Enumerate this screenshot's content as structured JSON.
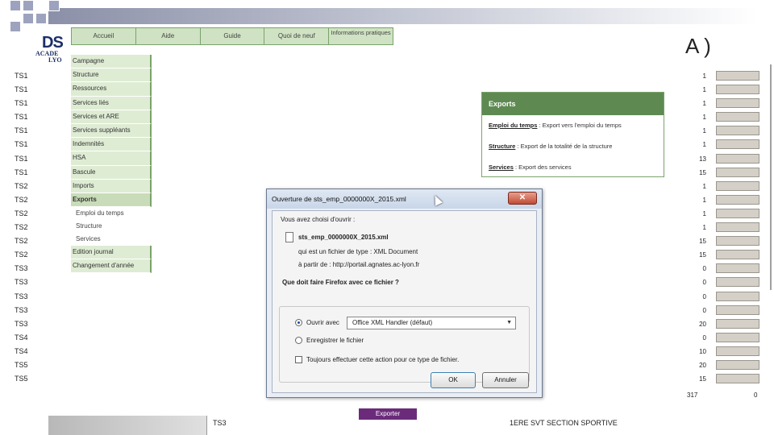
{
  "slide": {
    "logo_main": "DS",
    "logo_sub1": "ACADE",
    "logo_sub2": "LYO",
    "title_fragment": "A )"
  },
  "classes": [
    "TS1",
    "TS1",
    "TS1",
    "TS1",
    "TS1",
    "TS1",
    "TS1",
    "TS1",
    "TS2",
    "TS2",
    "TS2",
    "TS2",
    "TS2",
    "TS2",
    "TS3",
    "TS3",
    "TS3",
    "TS3",
    "TS3",
    "TS4",
    "TS4",
    "TS5",
    "TS5"
  ],
  "topnav": [
    "Accueil",
    "Aide",
    "Guide",
    "Quoi de neuf",
    "Informations pratiques"
  ],
  "menu": {
    "items": [
      "Campagne",
      "Structure",
      "Ressources",
      "Services liés",
      "Services et ARE",
      "Services suppléants",
      "Indemnités",
      "HSA",
      "Bascule",
      "Imports",
      "Exports"
    ],
    "submenu": [
      "Emploi du temps",
      "Structure",
      "Services"
    ],
    "tail": [
      "Edition journal",
      "Changement d'année"
    ]
  },
  "exports_panel": {
    "title": "Exports",
    "lines": [
      {
        "link": "Emploi du temps",
        "text": " : Export vers l'emploi du temps"
      },
      {
        "link": "Structure",
        "text": " : Export de la totalité de la structure"
      },
      {
        "link": "Services",
        "text": " : Export des services"
      }
    ]
  },
  "right_numbers": [
    "1",
    "1",
    "1",
    "1",
    "1",
    "1",
    "13",
    "15",
    "1",
    "1",
    "1",
    "1",
    "15",
    "15",
    "0",
    "0",
    "0",
    "0",
    "20",
    "0",
    "10",
    "20",
    "15"
  ],
  "right_totals": {
    "left": "317",
    "right": "0"
  },
  "bottom_strip": {
    "class": "TS3",
    "export_button": "Exporter",
    "section": "1ERE SVT SECTION SPORTIVE"
  },
  "dialog": {
    "title": "Ouverture de sts_emp_0000000X_2015.xml",
    "close": "✕",
    "intro": "Vous avez choisi d'ouvrir :",
    "filename": "sts_emp_0000000X_2015.xml",
    "type_line": "qui est un fichier de type : XML Document",
    "from_line": "à partir de : http://portail.agnates.ac-lyon.fr",
    "question": "Que doit faire Firefox avec ce fichier ?",
    "open_with_label": "Ouvrir avec",
    "open_with_value": "Office XML Handler (défaut)",
    "save_label": "Enregistrer le fichier",
    "always_label": "Toujours effectuer cette action pour ce type de fichier.",
    "ok": "OK",
    "cancel": "Annuler"
  }
}
